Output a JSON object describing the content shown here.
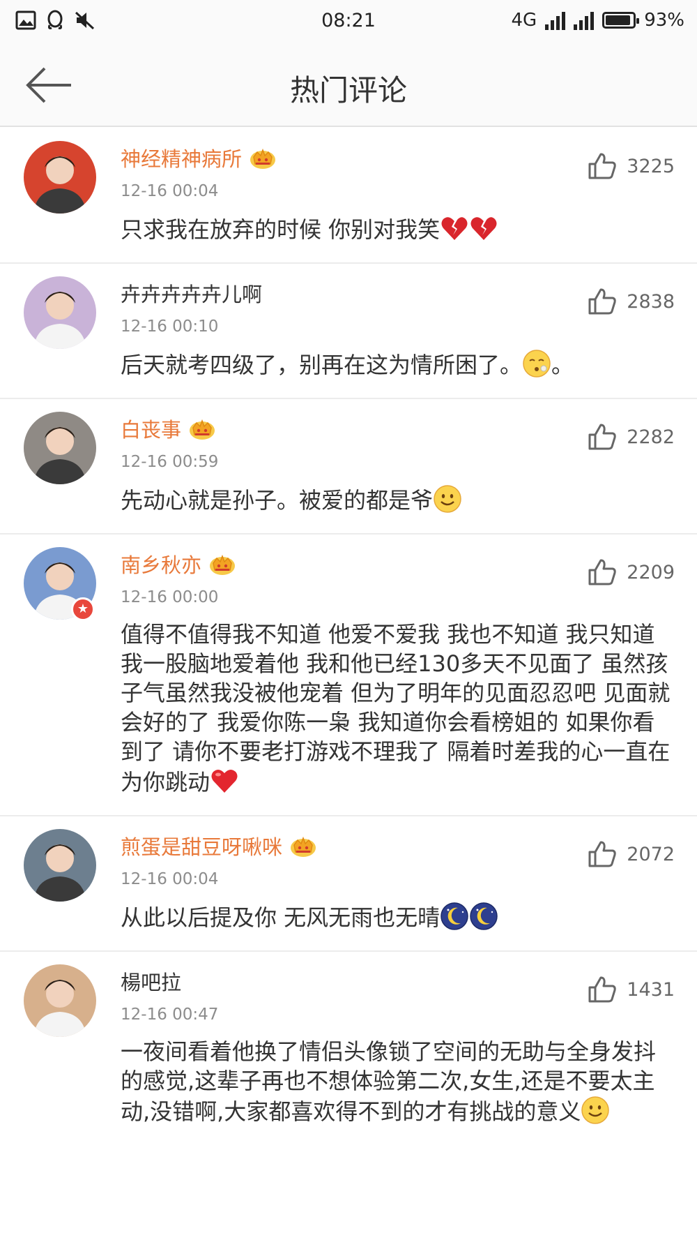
{
  "status": {
    "time": "08:21",
    "network": "4G",
    "battery": "93%",
    "battery_level": 0.93
  },
  "nav": {
    "title": "热门评论",
    "back_icon": "arrow-left-icon"
  },
  "comments": [
    {
      "name": "神经精神病所",
      "vip": true,
      "time": "12-16 00:04",
      "text": "只求我在放弃的时候 你别对我笑",
      "emojis": [
        "broken-heart-icon",
        "broken-heart-icon"
      ],
      "likes": "3225",
      "avatar_color": "#d6442e"
    },
    {
      "name": "卉卉卉卉卉儿啊",
      "vip": false,
      "time": "12-16 00:10",
      "text": "后天就考四级了，别再在这为情所困了。",
      "emojis": [
        "sleepy-face-icon"
      ],
      "text_after": "。",
      "likes": "2838",
      "avatar_color": "#c9b3d8"
    },
    {
      "name": "白丧事",
      "vip": true,
      "time": "12-16 00:59",
      "text": "先动心就是孙子。被爱的都是爷",
      "emojis": [
        "smile-face-icon"
      ],
      "likes": "2282",
      "avatar_color": "#8f8a85"
    },
    {
      "name": "南乡秋亦",
      "vip": true,
      "verified": true,
      "time": "12-16 00:00",
      "text": "值得不值得我不知道 他爱不爱我 我也不知道 我只知道我一股脑地爱着他 我和他已经130多天不见面了 虽然孩子气虽然我没被他宠着 但为了明年的见面忍忍吧 见面就会好的了 我爱你陈一枭 我知道你会看榜姐的 如果你看到了 请你不要老打游戏不理我了 隔着时差我的心一直在为你跳动",
      "emojis": [
        "red-heart-icon"
      ],
      "likes": "2209",
      "avatar_color": "#7a9bd0"
    },
    {
      "name": "煎蛋是甜豆呀啾咪",
      "vip": true,
      "time": "12-16 00:04",
      "text": "从此以后提及你 无风无雨也无晴",
      "emojis": [
        "moon-night-icon",
        "moon-night-icon"
      ],
      "likes": "2072",
      "avatar_color": "#6d7f8f"
    },
    {
      "name": "楊吧拉",
      "vip": false,
      "time": "12-16 00:47",
      "text": "一夜间看着他换了情侣头像锁了空间的无助与全身发抖的感觉,这辈子再也不想体验第二次,女生,还是不要太主动,没错啊,大家都喜欢得不到的才有挑战的意义",
      "emojis": [
        "smile-face-icon"
      ],
      "likes": "1431",
      "avatar_color": "#d7b08c"
    }
  ],
  "colors": {
    "vip_name": "#e8793a",
    "normal_name": "#333333",
    "time": "#8c8c8c",
    "divider": "#ececec"
  }
}
